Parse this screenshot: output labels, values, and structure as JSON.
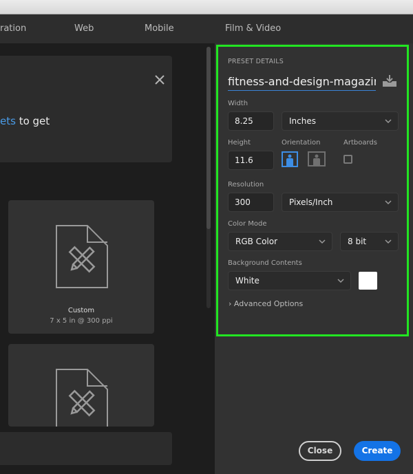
{
  "tabs": [
    {
      "label": "ration"
    },
    {
      "label": "Web"
    },
    {
      "label": "Mobile"
    },
    {
      "label": "Film & Video"
    }
  ],
  "banner": {
    "link_text": "ets",
    "text": " to get",
    "close_icon": "close-icon"
  },
  "presets": [
    {
      "name": "Custom",
      "dims": "7 x 5 in @ 300 ppi",
      "icon": "document-ruler-pencil-icon"
    },
    {
      "name": "",
      "dims": "",
      "icon": "document-ruler-pencil-icon"
    }
  ],
  "details": {
    "section_title": "PRESET DETAILS",
    "document_name": "fitness-and-design-magazine",
    "save_preset_icon": "save-preset-icon",
    "width": {
      "label": "Width",
      "value": "8.25",
      "unit": "Inches"
    },
    "height": {
      "label": "Height",
      "value": "11.6"
    },
    "orientation": {
      "label": "Orientation",
      "selected": "portrait"
    },
    "artboards": {
      "label": "Artboards",
      "checked": false
    },
    "resolution": {
      "label": "Resolution",
      "value": "300",
      "unit": "Pixels/Inch"
    },
    "color_mode": {
      "label": "Color Mode",
      "mode": "RGB Color",
      "depth": "8 bit"
    },
    "background": {
      "label": "Background Contents",
      "value": "White",
      "swatch_color": "#ffffff"
    },
    "advanced_label": "Advanced Options"
  },
  "buttons": {
    "close": "Close",
    "create": "Create"
  },
  "colors": {
    "accent": "#1473e6",
    "highlight": "#22e522"
  }
}
